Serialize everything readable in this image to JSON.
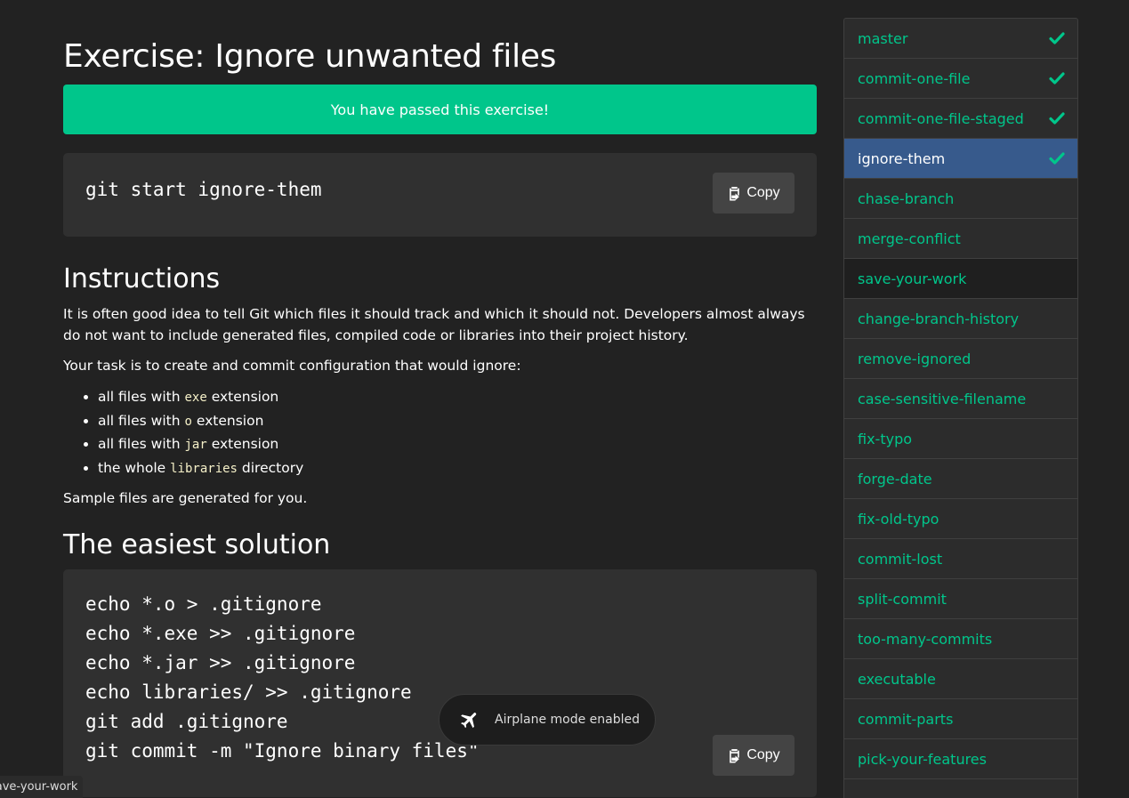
{
  "page": {
    "title": "Exercise: Ignore unwanted files",
    "success_message": "You have passed this exercise!"
  },
  "start_command": "git start ignore-them",
  "copy_label": "Copy",
  "instructions": {
    "heading": "Instructions",
    "paragraph1": "It is often good idea to tell Git which files it should track and which it should not. Developers almost always do not want to include generated files, compiled code or libraries into their project history.",
    "paragraph2": "Your task is to create and commit configuration that would ignore:",
    "items": [
      {
        "prefix": "all files with ",
        "code": "exe",
        "suffix": " extension"
      },
      {
        "prefix": "all files with ",
        "code": "o",
        "suffix": " extension"
      },
      {
        "prefix": "all files with ",
        "code": "jar",
        "suffix": " extension"
      },
      {
        "prefix": "the whole ",
        "code": "libraries",
        "suffix": " directory"
      }
    ],
    "paragraph3": "Sample files are generated for you."
  },
  "solution": {
    "heading": "The easiest solution",
    "lines": [
      "echo *.o > .gitignore",
      "echo *.exe >> .gitignore",
      "echo *.jar >> .gitignore",
      "echo libraries/ >> .gitignore",
      "git add .gitignore",
      "git commit -m \"Ignore binary files\""
    ]
  },
  "sidebar": {
    "items": [
      {
        "label": "master",
        "passed": true,
        "active": false
      },
      {
        "label": "commit-one-file",
        "passed": true,
        "active": false
      },
      {
        "label": "commit-one-file-staged",
        "passed": true,
        "active": false
      },
      {
        "label": "ignore-them",
        "passed": true,
        "active": true
      },
      {
        "label": "chase-branch",
        "passed": false,
        "active": false
      },
      {
        "label": "merge-conflict",
        "passed": false,
        "active": false
      },
      {
        "label": "save-your-work",
        "passed": false,
        "active": false,
        "hovered": true
      },
      {
        "label": "change-branch-history",
        "passed": false,
        "active": false
      },
      {
        "label": "remove-ignored",
        "passed": false,
        "active": false
      },
      {
        "label": "case-sensitive-filename",
        "passed": false,
        "active": false
      },
      {
        "label": "fix-typo",
        "passed": false,
        "active": false
      },
      {
        "label": "forge-date",
        "passed": false,
        "active": false
      },
      {
        "label": "fix-old-typo",
        "passed": false,
        "active": false
      },
      {
        "label": "commit-lost",
        "passed": false,
        "active": false
      },
      {
        "label": "split-commit",
        "passed": false,
        "active": false
      },
      {
        "label": "too-many-commits",
        "passed": false,
        "active": false
      },
      {
        "label": "executable",
        "passed": false,
        "active": false
      },
      {
        "label": "commit-parts",
        "passed": false,
        "active": false
      },
      {
        "label": "pick-your-features",
        "passed": false,
        "active": false
      },
      {
        "label": "",
        "passed": false,
        "active": false
      }
    ]
  },
  "toast": {
    "message": "Airplane mode enabled",
    "icon": "airplane-icon"
  },
  "status_link": "save-your-work",
  "colors": {
    "background": "#222222",
    "accent": "#00c68b",
    "active_item": "#375a8c",
    "code_background": "#303030"
  }
}
